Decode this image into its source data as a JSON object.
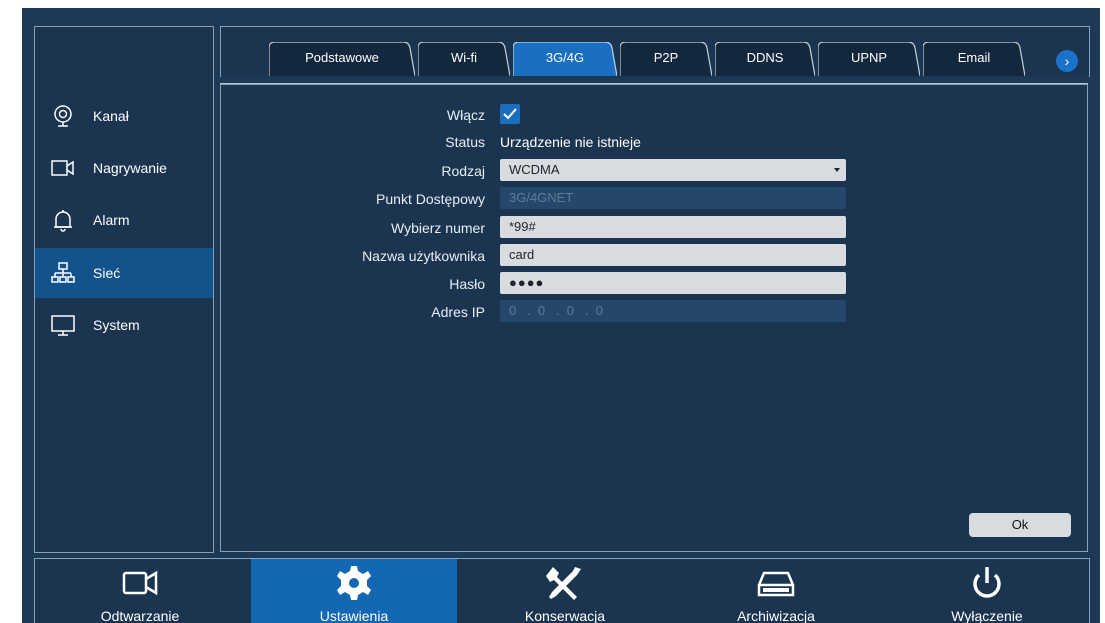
{
  "sidebar": {
    "items": [
      {
        "label": "Kanał",
        "icon": "camera-lens-icon",
        "active": false
      },
      {
        "label": "Nagrywanie",
        "icon": "video-camera-icon",
        "active": false
      },
      {
        "label": "Alarm",
        "icon": "bell-icon",
        "active": false
      },
      {
        "label": "Sieć",
        "icon": "network-icon",
        "active": true
      },
      {
        "label": "System",
        "icon": "monitor-icon",
        "active": false
      }
    ]
  },
  "tabs": [
    {
      "label": "Podstawowe",
      "active": false
    },
    {
      "label": "Wi-fi",
      "active": false
    },
    {
      "label": "3G/4G",
      "active": true
    },
    {
      "label": "P2P",
      "active": false
    },
    {
      "label": "DDNS",
      "active": false
    },
    {
      "label": "UPNP",
      "active": false
    },
    {
      "label": "Email",
      "active": false
    }
  ],
  "next_tab_icon": "chevron-right-icon",
  "form": {
    "enable_label": "Włącz",
    "enable_checked": true,
    "status_label": "Status",
    "status_value": "Urządzenie nie istnieje",
    "type_label": "Rodzaj",
    "type_value": "WCDMA",
    "apn_label": "Punkt Dostępowy",
    "apn_value": "3G/4GNET",
    "dial_label": "Wybierz numer",
    "dial_value": "*99#",
    "user_label": "Nazwa użytkownika",
    "user_value": "card",
    "password_label": "Hasło",
    "password_value": "●●●●",
    "ip_label": "Adres IP",
    "ip_value": "0   .  0   .  0   .  0"
  },
  "ok_label": "Ok",
  "bottom": {
    "items": [
      {
        "label": "Odtwarzanie",
        "icon": "playback-camera-icon",
        "active": false
      },
      {
        "label": "Ustawienia",
        "icon": "gear-icon",
        "active": true
      },
      {
        "label": "Konserwacja",
        "icon": "tools-icon",
        "active": false
      },
      {
        "label": "Archiwizacja",
        "icon": "drive-icon",
        "active": false
      },
      {
        "label": "Wyłączenie",
        "icon": "power-icon",
        "active": false
      }
    ]
  },
  "colors": {
    "background": "#1c3a56",
    "accent": "#1467b3",
    "active_side": "#13538b"
  }
}
